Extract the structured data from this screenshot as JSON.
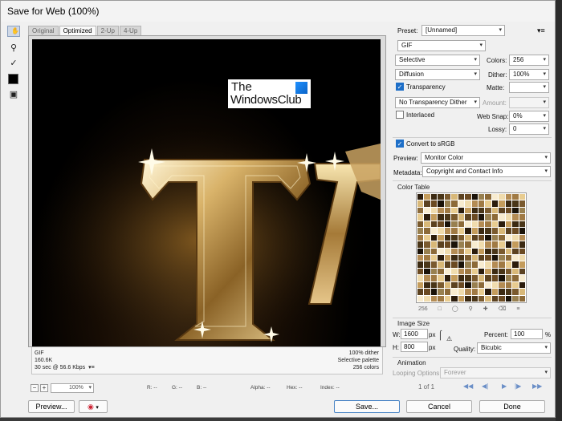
{
  "window": {
    "title": "Save for Web (100%)"
  },
  "tabs": [
    "Original",
    "Optimized",
    "2-Up",
    "4-Up"
  ],
  "active_tab": "Optimized",
  "watermark": {
    "line1": "The",
    "line2": "WindowsClub"
  },
  "status_left": [
    "GIF",
    "160.6K",
    "30 sec @ 56.6 Kbps"
  ],
  "status_right": [
    "100% dither",
    "Selective palette",
    "256 colors"
  ],
  "zoom": "100%",
  "readout": {
    "r": "R: --",
    "g": "G: --",
    "b": "B: --",
    "alpha": "Alpha: --",
    "hex": "Hex: --",
    "index": "Index: --"
  },
  "buttons": {
    "preview": "Preview...",
    "save": "Save...",
    "cancel": "Cancel",
    "done": "Done"
  },
  "settings": {
    "preset_label": "Preset:",
    "preset_value": "[Unnamed]",
    "format": "GIF",
    "reduction": "Selective",
    "colors_label": "Colors:",
    "colors_value": "256",
    "dither_algo": "Diffusion",
    "dither_label": "Dither:",
    "dither_value": "100%",
    "transparency_label": "Transparency",
    "transparency_checked": true,
    "matte_label": "Matte:",
    "transparency_dither": "No Transparency Dither",
    "amount_label": "Amount:",
    "interlaced_label": "Interlaced",
    "interlaced_checked": false,
    "websnap_label": "Web Snap:",
    "websnap_value": "0%",
    "lossy_label": "Lossy:",
    "lossy_value": "0",
    "convert_srgb_label": "Convert to sRGB",
    "convert_srgb_checked": true,
    "preview_label": "Preview:",
    "preview_value": "Monitor Color",
    "metadata_label": "Metadata:",
    "metadata_value": "Copyright and Contact Info"
  },
  "color_table": {
    "title": "Color Table",
    "count": "256"
  },
  "image_size": {
    "title": "Image Size",
    "w_label": "W:",
    "w_value": "1600",
    "h_label": "H:",
    "h_value": "800",
    "unit": "px",
    "percent_label": "Percent:",
    "percent_value": "100",
    "percent_unit": "%",
    "quality_label": "Quality:",
    "quality_value": "Bicubic"
  },
  "animation": {
    "title": "Animation",
    "looping_label": "Looping Options:",
    "looping_value": "Forever",
    "frame_counter": "1 of 1"
  },
  "colors": {
    "accent": "#1e6fc8",
    "palette": [
      "#2b1c0c",
      "#6b4a22",
      "#a07a44",
      "#d8b878",
      "#f0dcae",
      "#4a3618",
      "#8c6a38",
      "#c49c5c",
      "#1a1208",
      "#e8cc90",
      "#5c4220",
      "#b48c54",
      "#7a5a2e",
      "#f8ecd0",
      "#3c2a12",
      "#988050"
    ]
  }
}
